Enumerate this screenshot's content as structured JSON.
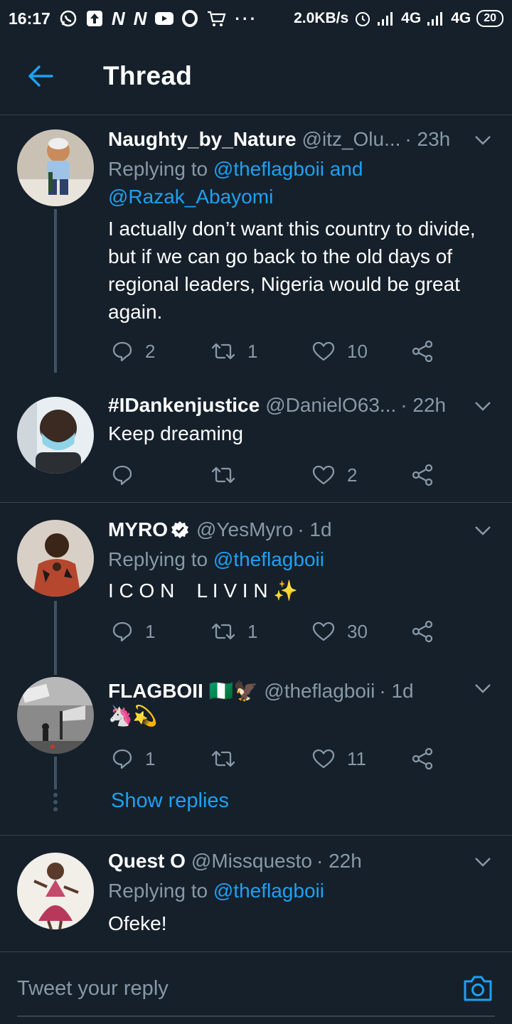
{
  "status_bar": {
    "time": "16:17",
    "speed": "2.0KB/s",
    "network1": "4G",
    "network2": "4G",
    "battery": "20"
  },
  "header": {
    "title": "Thread"
  },
  "tweets": [
    {
      "name": "Naughty_by_Nature",
      "handle": "@itz_Olu...",
      "time": "· 23h",
      "reply_prefix": "Replying to ",
      "reply_mentions": "@theflagboii and @Razak_Abayomi",
      "text": "I actually don’t want this country to divide, but if we can go back to the old days of regional leaders, Nigeria would be great again.",
      "replies": "2",
      "retweets": "1",
      "likes": "10"
    },
    {
      "name": "#IDankenjustice",
      "handle": "@DanielO63...",
      "time": "· 22h",
      "text": "Keep dreaming",
      "replies": "",
      "retweets": "",
      "likes": "2"
    },
    {
      "name": "MYRO",
      "handle": "@YesMyro",
      "time": "· 1d",
      "reply_prefix": "Replying to ",
      "reply_mentions": "@theflagboii",
      "text": "I C O N    L I V I N ✨",
      "replies": "1",
      "retweets": "1",
      "likes": "30"
    },
    {
      "name": "FLAGBOII 🇳🇬🦅",
      "handle": "@theflagboii",
      "time": "· 1d",
      "text": "🦄💫",
      "replies": "1",
      "retweets": "",
      "likes": "11"
    },
    {
      "name": "Quest O",
      "handle": "@Missquesto",
      "time": "· 22h",
      "reply_prefix": "Replying to ",
      "reply_mentions": "@theflagboii",
      "text": "Ofeke!"
    }
  ],
  "show_replies": "Show replies",
  "reply_box": {
    "placeholder": "Tweet your reply"
  },
  "colors": {
    "background": "#15202b",
    "accent": "#1da1f2",
    "secondary_text": "#8899a6",
    "divider": "#38444d"
  }
}
